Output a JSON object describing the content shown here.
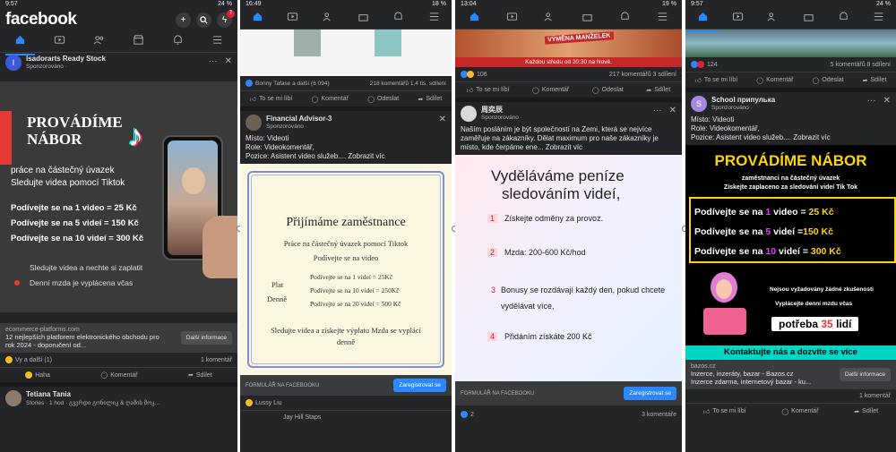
{
  "p1": {
    "status": {
      "time": "9:57",
      "right": "24 %"
    },
    "logo": "facebook",
    "notif": "7",
    "ad": {
      "name": "Isadorarts Ready Stock",
      "sub": "Sponzorováno ·",
      "title": "PROVÁDÍME NÁBOR",
      "lines": [
        "práce na částečný úvazek",
        "Sledujte videa pomocí Tiktok"
      ],
      "rates": [
        "Podívejte se na 1 video = 25 Kč",
        "Podívejte se na 5 videí = 150 Kč",
        "Podívejte se na 10 videí = 300 Kč"
      ],
      "foot": [
        "Sledujte videa a nechte si zaplatit",
        "Denní mzda je vyplácena včas"
      ]
    },
    "link": {
      "domain": "ecommerce-platforms.com",
      "title": "12 nejlepších platforem elektronického obchodu pro rok 2024 - doporučení od...",
      "btn": "Další informace"
    },
    "react": {
      "left": "Vy a další (1)",
      "right": "1 komentář"
    },
    "actions": [
      "Haha",
      "Komentář",
      "Sdílet"
    ],
    "story": {
      "name": "Tetiana Tania",
      "sub": "Stories · 1 hod · გვერდი გონილიკ & ღამის მოკ..."
    }
  },
  "p2": {
    "status": {
      "time": "16:49",
      "right": "18 %"
    },
    "react": {
      "left": "Bonny Tafase a další (6 094)",
      "right": "218 komentářů  1,4 tis. sdílení"
    },
    "actions": [
      "To se mi líbí",
      "Komentář",
      "Odeslat",
      "Sdílet"
    ],
    "post": {
      "name": "Financial Advisor-3",
      "sub": "Sponzorováno ·",
      "text": [
        "Místo: Videoti",
        "Role: Videokomentář,",
        "Pozice: Asistent video služeb.... Zobrazit víc"
      ]
    },
    "card": {
      "title": "Přijímáme zaměstnance",
      "line1": "Práce na částečný úvazek pomocí Tiktok",
      "line2": "Podívejte se na video",
      "plat": "Plat",
      "denne": "Denně",
      "rates": [
        "Podívejte se na 1 videí =   25Kč",
        "Podívejte se na 10 videí =  250Kč",
        "Podívejte se na 20 videí = 500 Kč"
      ],
      "foot": "Sledujte videa a získejte výplatu Mzda se vyplácí denně"
    },
    "form": {
      "label": "FORMULÁŘ NA FACEBOOKU",
      "btn": "Zaregistrovat se"
    },
    "liker": "Lussy Liu",
    "next": "Jay Hill Staps"
  },
  "p3": {
    "status": {
      "time": "13:04",
      "right": "19 %"
    },
    "banner": {
      "title": "VÝMĚNA MANŽELEK",
      "sub": "Každou středu od 20:30 na Nově."
    },
    "react": {
      "left": "106",
      "right": "217 komentářů   3 sdílení"
    },
    "actions": [
      "To se mi líbí",
      "Komentář",
      "Odeslat",
      "Sdílet"
    ],
    "post": {
      "name": "周奕辰",
      "sub": "Sponzorováno ·",
      "text": "Naším posláním je být společností na Zemi, která se nejvíce zaměřuje na zákazníky. Dělat maximum pro naše zákazníky je místo, kde čerpáme ene... Zobrazit víc"
    },
    "card": {
      "title1": "Vyděláváme  peníze",
      "title2": "sledováním  videí,",
      "items": [
        {
          "n": "1",
          "t": "Získejte odměny za provoz."
        },
        {
          "n": "2",
          "t": "Mzda: 200-600 Kč/hod"
        },
        {
          "n": "3",
          "t": "Bonusy se rozdávají každý den, pokud chcete vydělávat více,"
        },
        {
          "n": "4",
          "t": "Přidáním získáte 200 Kč"
        }
      ]
    },
    "form": {
      "label": "FORMULÁŘ NA FACEBOOKU",
      "btn": "Zaregistrovat se"
    },
    "bottom": {
      "left": "2",
      "right": "3 komentáře"
    }
  },
  "p4": {
    "status": {
      "time": "9:57",
      "right": "24 %"
    },
    "react": {
      "left": "124",
      "right": "5 komentářů  8 sdílení"
    },
    "actions": [
      "To se mi líbí",
      "Komentář",
      "Odeslat",
      "Sdílet"
    ],
    "post": {
      "name": "School припулька",
      "sub": "Sponzorováno ·",
      "text": [
        "Místo: Videoti",
        "Role: Videokomentář,",
        "Pozice: Asistent video služeb.... Zobrazit víc"
      ]
    },
    "card": {
      "title": "PROVÁDÍME NÁBOR",
      "l1": "zaměstnanci na částečný úvazek",
      "l2": "Získejte zaplaceno za sledování videí Tik Tok",
      "rates": [
        {
          "a": "Podívejte se na ",
          "n": "1",
          "b": " video = ",
          "v": "25 Kč"
        },
        {
          "a": "Podívejte se na ",
          "n": "5",
          "b": " videí =",
          "v": "150 Kč"
        },
        {
          "a": "Podívejte se na ",
          "n": "10",
          "b": " videí = ",
          "v": "300 Kč"
        }
      ],
      "info1": "Nejsou vyžadovány žádné zkušenosti",
      "info2": "Vyplácejte denní mzdu včas",
      "need": "potřeba",
      "needn": "35",
      "needu": "lidí",
      "cta": "Kontaktujte nás a dozvíte se více"
    },
    "link": {
      "domain": "bazos.cz",
      "title": "Inzerce, inzeráty, bazar - Bazos.cz",
      "desc": "Inzerce zdarma, internetový bazar - ku...",
      "btn": "Další informace"
    },
    "comments": "1 komentář",
    "actions2": [
      "To se mi líbí",
      "Komentář",
      "Sdílet"
    ]
  },
  "colors": {
    "bg": "#242526",
    "blue": "#2d88ff",
    "yellow": "#ffd400",
    "cyan": "#00d6c6"
  }
}
